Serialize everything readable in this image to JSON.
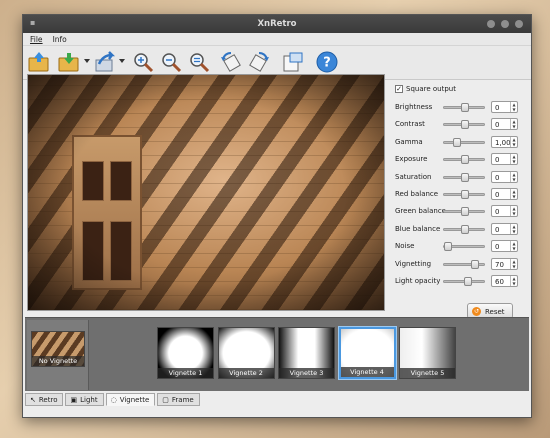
{
  "window": {
    "title": "XnRetro"
  },
  "menu": [
    "File",
    "Info"
  ],
  "toolbar": [
    {
      "name": "open-icon"
    },
    {
      "name": "save-icon"
    },
    {
      "name": "share-icon"
    },
    {
      "name": "zoom-in-icon"
    },
    {
      "name": "zoom-out-icon"
    },
    {
      "name": "zoom-fit-icon"
    },
    {
      "name": "rotate-left-icon"
    },
    {
      "name": "rotate-right-icon"
    },
    {
      "name": "export-icon"
    },
    {
      "name": "help-icon"
    }
  ],
  "panel": {
    "square_output_label": "Square output",
    "square_output_checked": true,
    "adjustments": [
      {
        "label": "Brightness",
        "value": "0",
        "level": 0.5
      },
      {
        "label": "Contrast",
        "value": "0",
        "level": 0.5
      },
      {
        "label": "Gamma",
        "value": "1,00",
        "level": 0.25
      },
      {
        "label": "Exposure",
        "value": "0",
        "level": 0.5
      },
      {
        "label": "Saturation",
        "value": "0",
        "level": 0.5
      },
      {
        "label": "Red balance",
        "value": "0",
        "level": 0.5
      },
      {
        "label": "Green balance",
        "value": "0",
        "level": 0.5
      },
      {
        "label": "Blue balance",
        "value": "0",
        "level": 0.5
      },
      {
        "label": "Noise",
        "value": "0",
        "level": 0.0
      },
      {
        "label": "Vignetting",
        "value": "70",
        "level": 0.78
      },
      {
        "label": "Light opacity",
        "value": "60",
        "level": 0.6
      }
    ],
    "reset_label": "Reset"
  },
  "strip": {
    "current": "No Vignette",
    "items": [
      {
        "label": "Vignette 1",
        "selected": false
      },
      {
        "label": "Vignette 2",
        "selected": false
      },
      {
        "label": "Vignette 3",
        "selected": false
      },
      {
        "label": "Vignette 4",
        "selected": true
      },
      {
        "label": "Vignette 5",
        "selected": false
      }
    ]
  },
  "tabs": [
    {
      "label": "Retro",
      "active": false
    },
    {
      "label": "Light",
      "active": false
    },
    {
      "label": "Vignette",
      "active": true
    },
    {
      "label": "Frame",
      "active": false
    }
  ]
}
